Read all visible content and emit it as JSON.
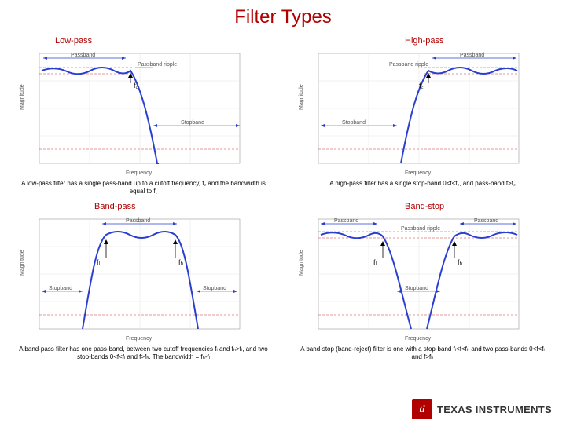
{
  "title": "Filter Types",
  "footer_brand": "TEXAS INSTRUMENTS",
  "footer_icon_text": "ti",
  "charts": {
    "lowpass": {
      "subtitle": "Low-pass",
      "caption": "A low-pass filter has a single pass-band up to a cutoff frequency, f꜀ and the bandwidth is equal to f꜀",
      "fc_label": "f꜀",
      "axis_x": "Frequency",
      "axis_y": "Magnitude",
      "lbl_passband": "Passband",
      "lbl_ripple": "Passband ripple",
      "lbl_stopband": "Stopband"
    },
    "highpass": {
      "subtitle": "High-pass",
      "caption": "A high-pass filter has a single stop-band 0<f<f꜀, and pass-band f>f꜀",
      "fc_label": "f꜀",
      "axis_x": "Frequency",
      "axis_y": "Magnitude",
      "lbl_passband": "Passband",
      "lbl_ripple": "Passband ripple",
      "lbl_stopband": "Stopband"
    },
    "bandpass": {
      "subtitle": "Band-pass",
      "caption": "A band-pass filter has one pass-band, between two cutoff frequencies fₗ and fₕ>fₗ, and two stop-bands 0<f<fₗ and f>fₕ. The bandwidth = fₕ-fₗ",
      "fl_label": "fₗ",
      "fh_label": "fₕ",
      "axis_x": "Frequency",
      "axis_y": "Magnitude",
      "lbl_passband": "Passband",
      "lbl_stopband": "Stopband"
    },
    "bandstop": {
      "subtitle": "Band-stop",
      "caption": "A band-stop (band-reject) filter is one with a stop-band fₗ<f<fₕ and two pass-bands 0<f<fₗ and f>fₕ",
      "fl_label": "fₗ",
      "fh_label": "fₕ",
      "axis_x": "Frequency",
      "axis_y": "Magnitude",
      "lbl_passband": "Passband",
      "lbl_ripple": "Passband ripple",
      "lbl_stopband": "Stopband"
    }
  },
  "chart_data": [
    {
      "type": "line",
      "title": "Low-pass",
      "xlabel": "Frequency",
      "ylabel": "Magnitude",
      "features": {
        "passband": [
          0,
          0.45
        ],
        "stopband": [
          0.62,
          1
        ],
        "cutoff": 0.45,
        "ripple_db": 1
      }
    },
    {
      "type": "line",
      "title": "High-pass",
      "xlabel": "Frequency",
      "ylabel": "Magnitude",
      "features": {
        "passband": [
          0.55,
          1
        ],
        "stopband": [
          0,
          0.38
        ],
        "cutoff": 0.55,
        "ripple_db": 1
      }
    },
    {
      "type": "line",
      "title": "Band-pass",
      "xlabel": "Frequency",
      "ylabel": "Magnitude",
      "features": {
        "passband": [
          0.32,
          0.68
        ],
        "stopband_low": [
          0,
          0.2
        ],
        "stopband_high": [
          0.8,
          1
        ],
        "f_low": 0.32,
        "f_high": 0.68
      }
    },
    {
      "type": "line",
      "title": "Band-stop",
      "xlabel": "Frequency",
      "ylabel": "Magnitude",
      "features": {
        "passband_low": [
          0,
          0.3
        ],
        "passband_high": [
          0.7,
          1
        ],
        "stopband": [
          0.4,
          0.6
        ],
        "f_low": 0.3,
        "f_high": 0.7,
        "ripple_db": 1
      }
    }
  ]
}
